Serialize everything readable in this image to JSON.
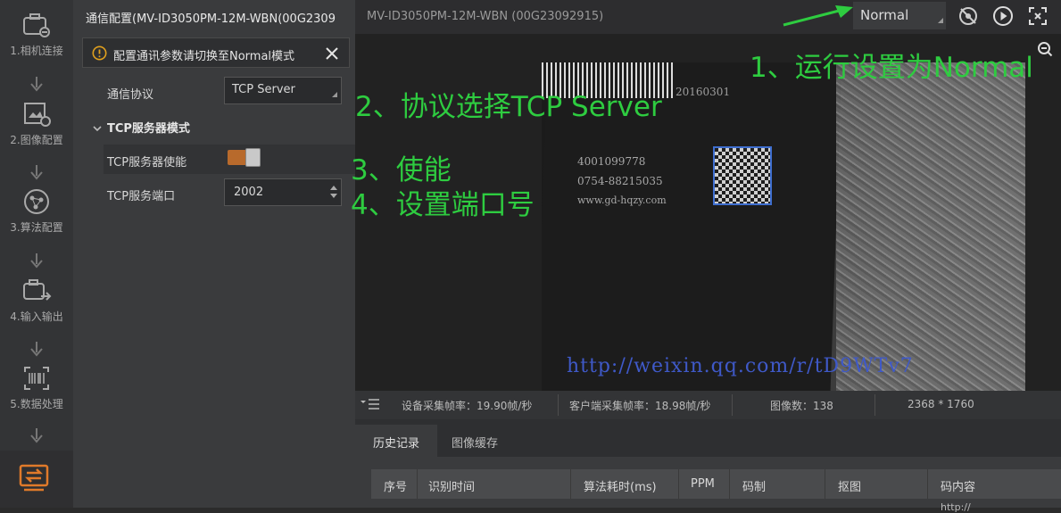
{
  "left_rail": {
    "steps": [
      {
        "label": "1.相机连接",
        "icon": "camera-link-icon"
      },
      {
        "label": "2.图像配置",
        "icon": "image-settings-icon"
      },
      {
        "label": "3.算法配置",
        "icon": "algorithm-icon"
      },
      {
        "label": "4.输入输出",
        "icon": "io-icon"
      },
      {
        "label": "5.数据处理",
        "icon": "barcode-icon"
      }
    ],
    "comm_icon": "communication-icon"
  },
  "panel": {
    "title": "通信配置(MV-ID3050PM-12M-WBN(00G2309",
    "warning": "配置通讯参数请切换至Normal模式",
    "protocol_label": "通信协议",
    "protocol_value": "TCP Server",
    "section_title": "TCP服务器模式",
    "enable_label": "TCP服务器使能",
    "port_label": "TCP服务端口",
    "port_value": "2002"
  },
  "viewer": {
    "device_title": "MV-ID3050PM-12M-WBN (00G23092915)",
    "mode_value": "Normal",
    "image_url_text": "http://weixin.qq.com/r/tD9WTv7",
    "label_lines": [
      "20160301",
      "4001099778",
      "0754-88215035",
      "www.gd-hqzy.com"
    ]
  },
  "status_bar": {
    "device_fps": "设备采集帧率：19.90帧/秒",
    "client_fps": "客户端采集帧率：18.98帧/秒",
    "image_count": "图像数：138",
    "resolution": "2368 * 1760"
  },
  "history": {
    "tabs": [
      "历史记录",
      "图像缓存"
    ],
    "columns": [
      "序号",
      "识别时间",
      "算法耗时(ms)",
      "PPM",
      "码制",
      "抠图",
      "码内容"
    ],
    "partial_cell": "http://"
  },
  "annotations": {
    "step1": "1、运行设置为Normal",
    "step2": "2、协议选择TCP Server",
    "step3": "3、使能",
    "step4": "4、设置端口号"
  },
  "colors": {
    "accent_orange": "#e07a2a",
    "annotation_green": "#2ecc40",
    "url_blue": "#3f59c8"
  }
}
